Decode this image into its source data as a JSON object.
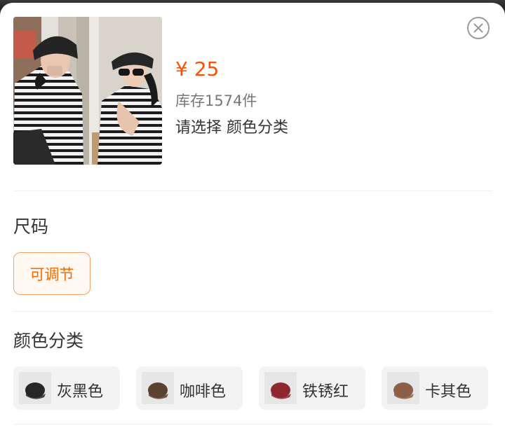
{
  "product": {
    "price": "¥ 25",
    "stock": "库存1574件",
    "selection_hint": "请选择 颜色分类"
  },
  "icons": {
    "close": "close-icon"
  },
  "size_section": {
    "title": "尺码",
    "options": [
      {
        "label": "可调节",
        "selected": true
      }
    ]
  },
  "color_section": {
    "title": "颜色分类",
    "options": [
      {
        "label": "灰黑色",
        "cap_color": "#262626"
      },
      {
        "label": "咖啡色",
        "cap_color": "#5c4030"
      },
      {
        "label": "铁锈红",
        "cap_color": "#8e2730"
      },
      {
        "label": "卡其色",
        "cap_color": "#8c6048"
      }
    ]
  },
  "colors": {
    "accent": "#ff5000",
    "selected_border": "#f2a268",
    "selected_text": "#f56a00"
  }
}
